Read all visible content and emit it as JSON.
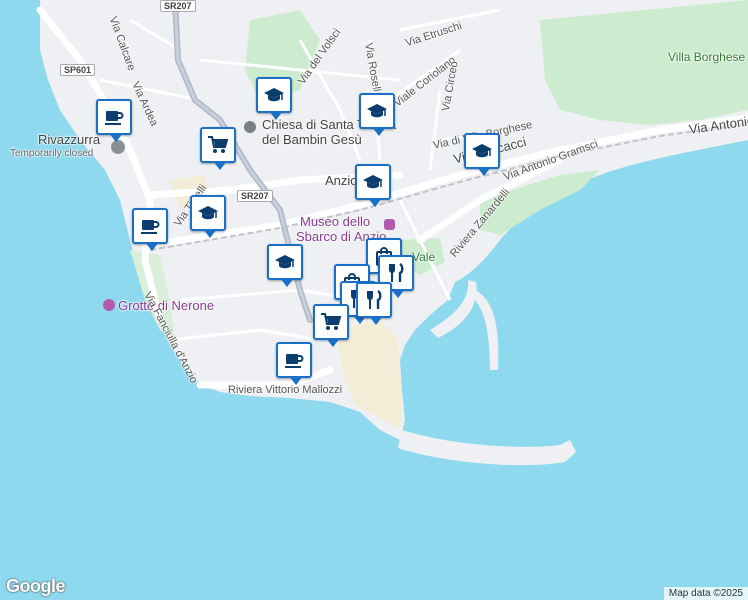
{
  "map": {
    "logo": "Google",
    "attribution": "Map data ©2025",
    "colors": {
      "water": "#8fd9ef",
      "land": "#eef0f3",
      "park": "#cdeccf",
      "pin_border": "#1a6fc7",
      "icon": "#0b3d6e"
    },
    "labels": {
      "via_calcare": "Via Calcare",
      "sr207_top": "SR207",
      "sp601": "SP601",
      "via_ardea": "Via Ardea",
      "rivazzurra": "Rivazzurra",
      "rivazzurra_status": "Temporarily closed",
      "via_del_volsci": "Via del Volsci",
      "via_rosell": "Via Rosell",
      "viale_coriolano": "Viale Coriolano",
      "via_etruschi": "Via Etruschi",
      "via_circeo": "Via Circeo",
      "villa_borghese": "Villa Borghese",
      "via_antonio": "Via Antonio",
      "via_di_villa_borghese": "Via di Villa Borghese",
      "chiesa_line1": "Chiesa di Santa Teresa",
      "chiesa_line2": "del Bambin Gesù",
      "via_paccacci": "Via Paccacci",
      "via_antonio_gramsci": "Via Antonio Gramsci",
      "sr207_mid": "SR207",
      "anzio": "Anzio",
      "via_tirrelli": "Via Tirrelli",
      "museo_line1": "Museo dello",
      "museo_line2": "Sbarco di Anzio",
      "riviera_zanardelli": "Riviera Zanardelli",
      "vale": "Vale",
      "grotte_di_nerone": "Grotte di Nerone",
      "via_fanciulla": "Via Fanciulla d'Anzio",
      "riviera_mallozzi": "Riviera Vittorio Mallozzi"
    },
    "pins": [
      {
        "name": "coffee",
        "icon": "coffee-icon"
      },
      {
        "name": "shopping-cart",
        "icon": "cart-icon"
      },
      {
        "name": "school",
        "icon": "graduation-cap-icon"
      },
      {
        "name": "school",
        "icon": "graduation-cap-icon"
      },
      {
        "name": "school",
        "icon": "graduation-cap-icon"
      },
      {
        "name": "school",
        "icon": "graduation-cap-icon"
      },
      {
        "name": "coffee",
        "icon": "coffee-icon"
      },
      {
        "name": "school",
        "icon": "graduation-cap-icon"
      },
      {
        "name": "school",
        "icon": "graduation-cap-icon"
      },
      {
        "name": "bag",
        "icon": "bag-icon"
      },
      {
        "name": "bag",
        "icon": "bag-icon"
      },
      {
        "name": "restaurant",
        "icon": "fork-knife-icon"
      },
      {
        "name": "restaurant",
        "icon": "fork-knife-icon"
      },
      {
        "name": "shopping-cart",
        "icon": "cart-icon"
      },
      {
        "name": "coffee",
        "icon": "coffee-icon"
      },
      {
        "name": "restaurant",
        "icon": "fork-knife-icon"
      }
    ]
  }
}
